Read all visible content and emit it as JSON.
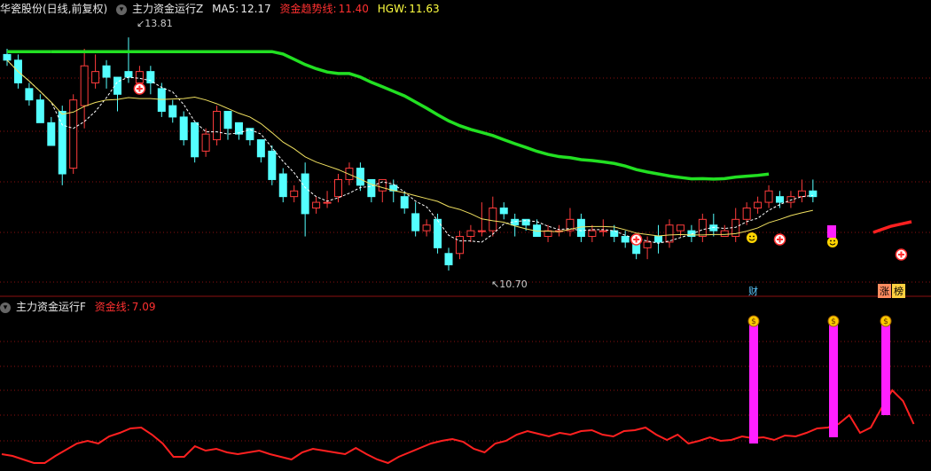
{
  "top": {
    "stock": "华瓷股份(日线,前复权)",
    "indicator": "主力资金运行Z",
    "ma5_label": "MA5:",
    "ma5_value": "12.17",
    "trend_label": "资金趋势线:",
    "trend_value": "11.40",
    "hgw_label": "HGW:",
    "hgw_value": "11.63",
    "high_label": "13.81",
    "low_label": "10.70",
    "tag_cai": "财",
    "tag_zhang": "涨",
    "tag_bang": "榜"
  },
  "bottom": {
    "indicator": "主力资金运行F",
    "line_label": "资金线:",
    "line_value": "7.09"
  },
  "colors": {
    "up": "#ff3c3c",
    "down": "#54ffff",
    "ma_white": "#ffffff",
    "ma_yellow": "#f0e060",
    "trend_green": "#22e022",
    "trend_red": "#ff2020",
    "magenta": "#ff20ff",
    "grid": "#8b1010"
  },
  "chart_data": [
    {
      "type": "candlestick",
      "title": "华瓷股份(日线,前复权)",
      "series": [
        {
          "name": "MA5",
          "value_label": "12.17"
        },
        {
          "name": "资金趋势线",
          "value_label": "11.40"
        },
        {
          "name": "HGW",
          "value_label": "11.63"
        }
      ],
      "annotations": [
        "13.81",
        "10.70",
        "财",
        "涨",
        "榜"
      ],
      "candles": [
        [
          13.5,
          13.4,
          13.6,
          13.3
        ],
        [
          13.4,
          13.0,
          13.5,
          12.9
        ],
        [
          12.9,
          12.7,
          13.0,
          12.6
        ],
        [
          12.7,
          12.3,
          12.8,
          12.3
        ],
        [
          12.3,
          11.9,
          12.4,
          11.9
        ],
        [
          12.5,
          11.4,
          12.6,
          11.2
        ],
        [
          11.5,
          12.7,
          12.8,
          11.4
        ],
        [
          12.6,
          13.3,
          13.6,
          12.2
        ],
        [
          13.0,
          13.2,
          13.5,
          12.9
        ],
        [
          13.3,
          13.1,
          13.4,
          12.9
        ],
        [
          13.1,
          12.8,
          13.1,
          12.5
        ],
        [
          13.2,
          13.1,
          13.8,
          13.0
        ],
        [
          13.0,
          13.2,
          13.3,
          12.8
        ],
        [
          13.2,
          13.0,
          13.3,
          12.8
        ],
        [
          12.9,
          12.5,
          13.0,
          12.4
        ],
        [
          12.6,
          12.4,
          12.7,
          12.3
        ],
        [
          12.4,
          12.0,
          12.5,
          11.9
        ],
        [
          12.3,
          11.7,
          12.3,
          11.6
        ],
        [
          11.8,
          12.1,
          12.2,
          11.7
        ],
        [
          12.0,
          12.5,
          12.6,
          11.9
        ],
        [
          12.5,
          12.2,
          12.5,
          12.0
        ],
        [
          12.3,
          12.1,
          12.3,
          12.0
        ],
        [
          12.2,
          12.0,
          12.2,
          11.9
        ],
        [
          12.0,
          11.7,
          12.0,
          11.6
        ],
        [
          11.8,
          11.3,
          11.9,
          11.2
        ],
        [
          11.4,
          11.0,
          11.5,
          10.9
        ],
        [
          11.0,
          11.1,
          11.2,
          10.9
        ],
        [
          11.4,
          10.7,
          11.6,
          10.3
        ],
        [
          10.8,
          10.9,
          11.0,
          10.7
        ],
        [
          10.9,
          10.9,
          11.1,
          10.8
        ],
        [
          11.0,
          11.3,
          11.4,
          10.9
        ],
        [
          11.3,
          11.5,
          11.6,
          11.2
        ],
        [
          11.5,
          11.2,
          11.6,
          11.1
        ],
        [
          11.3,
          11.0,
          11.3,
          10.9
        ],
        [
          11.1,
          11.3,
          11.3,
          10.9
        ],
        [
          11.2,
          11.1,
          11.3,
          10.9
        ],
        [
          11.0,
          10.8,
          11.1,
          10.7
        ],
        [
          10.7,
          10.4,
          10.9,
          10.3
        ],
        [
          10.4,
          10.5,
          10.6,
          10.3
        ],
        [
          10.6,
          10.1,
          10.7,
          10.0
        ],
        [
          10.0,
          9.8,
          10.1,
          9.7
        ],
        [
          10.0,
          10.3,
          10.4,
          9.9
        ],
        [
          10.3,
          10.4,
          10.5,
          10.2
        ],
        [
          10.4,
          10.4,
          10.9,
          10.3
        ],
        [
          10.4,
          10.8,
          11.0,
          10.3
        ],
        [
          10.8,
          10.7,
          10.9,
          10.6
        ],
        [
          10.6,
          10.5,
          10.7,
          10.3
        ],
        [
          10.6,
          10.5,
          10.6,
          10.4
        ],
        [
          10.5,
          10.3,
          10.6,
          10.3
        ],
        [
          10.3,
          10.4,
          10.5,
          10.2
        ],
        [
          10.4,
          10.4,
          10.5,
          10.3
        ],
        [
          10.4,
          10.6,
          10.8,
          10.3
        ],
        [
          10.6,
          10.3,
          10.7,
          10.2
        ],
        [
          10.3,
          10.4,
          10.5,
          10.2
        ],
        [
          10.4,
          10.4,
          10.6,
          10.3
        ],
        [
          10.4,
          10.3,
          10.5,
          10.2
        ],
        [
          10.3,
          10.2,
          10.4,
          10.1
        ],
        [
          10.2,
          10.0,
          10.3,
          9.9
        ],
        [
          10.1,
          10.2,
          10.3,
          9.9
        ],
        [
          10.3,
          10.2,
          10.5,
          10.0
        ],
        [
          10.2,
          10.5,
          10.6,
          10.1
        ],
        [
          10.4,
          10.5,
          10.5,
          10.3
        ],
        [
          10.4,
          10.3,
          10.5,
          10.2
        ],
        [
          10.3,
          10.6,
          10.7,
          10.2
        ],
        [
          10.5,
          10.4,
          10.7,
          10.3
        ],
        [
          10.3,
          10.4,
          10.5,
          10.3
        ],
        [
          10.3,
          10.6,
          10.8,
          10.2
        ],
        [
          10.6,
          10.8,
          10.9,
          10.5
        ],
        [
          10.8,
          10.9,
          11.0,
          10.7
        ],
        [
          10.9,
          11.1,
          11.2,
          10.8
        ],
        [
          11.0,
          10.9,
          11.1,
          10.8
        ],
        [
          10.9,
          11.0,
          11.1,
          10.8
        ],
        [
          11.0,
          11.1,
          11.3,
          10.9
        ],
        [
          11.1,
          11.0,
          11.3,
          10.9
        ]
      ]
    },
    {
      "type": "line",
      "title": "主力资金运行F",
      "series": [
        {
          "name": "资金线",
          "value_label": "7.09"
        }
      ]
    }
  ]
}
